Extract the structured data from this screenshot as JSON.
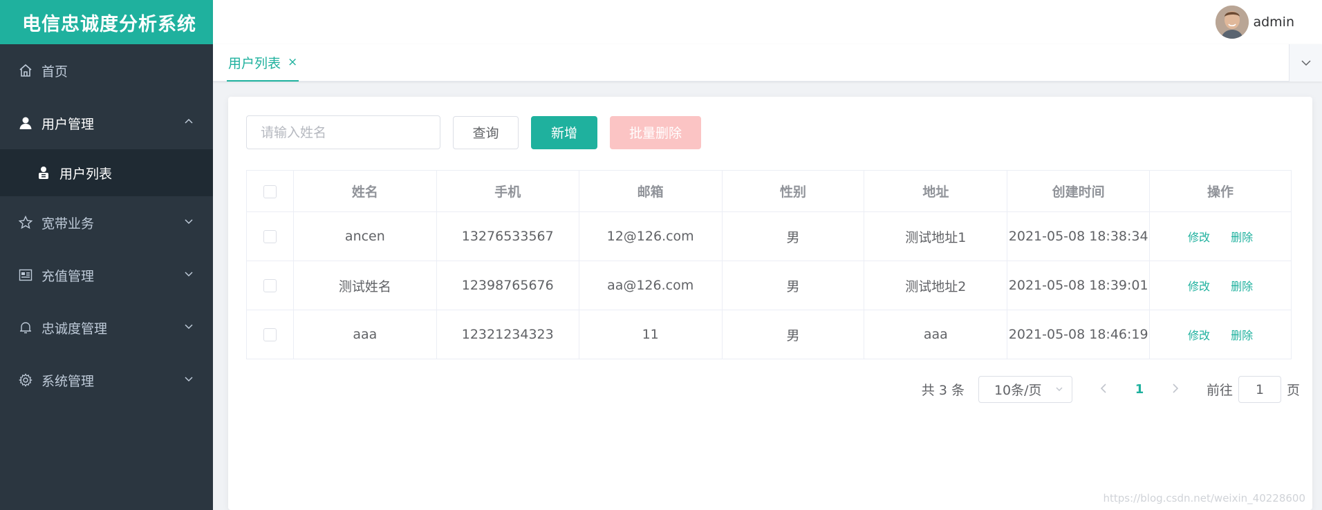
{
  "app": {
    "title": "电信忠诚度分析系统"
  },
  "header": {
    "username": "admin"
  },
  "sidebar": {
    "items": [
      {
        "label": "首页",
        "icon": "home-icon"
      },
      {
        "label": "用户管理",
        "icon": "user-icon",
        "expanded": true,
        "children": [
          {
            "label": "用户列表",
            "icon": "user-list-icon"
          }
        ]
      },
      {
        "label": "宽带业务",
        "icon": "star-icon"
      },
      {
        "label": "充值管理",
        "icon": "card-icon"
      },
      {
        "label": "忠诚度管理",
        "icon": "bell-icon"
      },
      {
        "label": "系统管理",
        "icon": "gear-icon"
      }
    ]
  },
  "tabs": [
    {
      "label": "用户列表",
      "close": "×"
    }
  ],
  "toolbar": {
    "search_placeholder": "请输入姓名",
    "query_label": "查询",
    "add_label": "新增",
    "batch_delete_label": "批量删除"
  },
  "table": {
    "headers": [
      "姓名",
      "手机",
      "邮箱",
      "性别",
      "地址",
      "创建时间",
      "操作"
    ],
    "rows": [
      [
        "ancen",
        "13276533567",
        "12@126.com",
        "男",
        "测试地址1",
        "2021-05-08 18:38:34"
      ],
      [
        "测试姓名",
        "12398765676",
        "aa@126.com",
        "男",
        "测试地址2",
        "2021-05-08 18:39:01"
      ],
      [
        "aaa",
        "12321234323",
        "11",
        "男",
        "aaa",
        "2021-05-08 18:46:19"
      ]
    ],
    "edit_label": "修改",
    "delete_label": "删除"
  },
  "pagination": {
    "total_text": "共 3 条",
    "page_size": "10条/页",
    "current_page": "1",
    "goto_prefix": "前往",
    "goto_value": "1",
    "goto_suffix": "页"
  },
  "watermark": "https://blog.csdn.net/weixin_40228600",
  "colors": {
    "accent": "#1fb19e",
    "sidebar_bg": "#2b3640",
    "danger_light": "#fbc4c4"
  }
}
